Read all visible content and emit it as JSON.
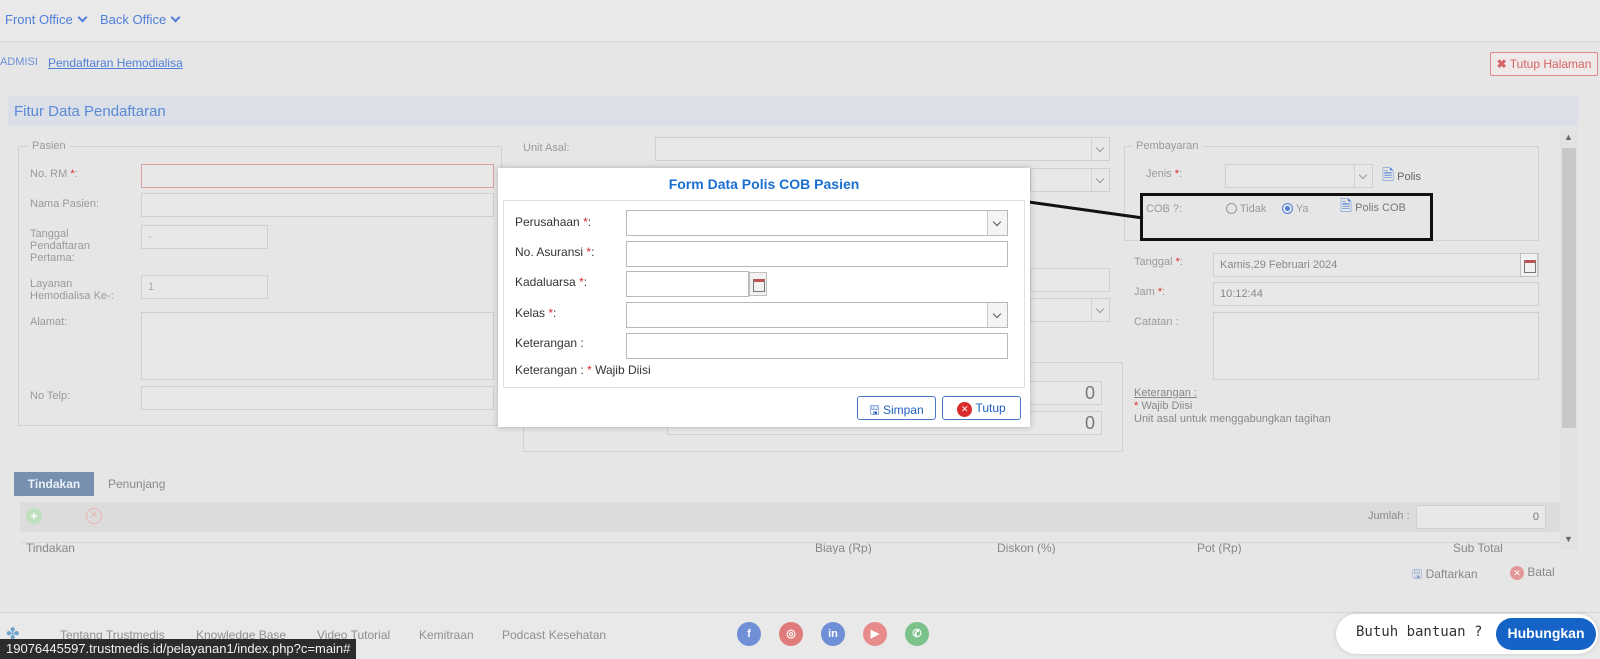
{
  "nav": {
    "front_office": "Front Office",
    "back_office": "Back Office"
  },
  "breadcrumb": {
    "root": "ADMISI",
    "current": "Pendaftaran Hemodialisa"
  },
  "close_page": "Tutup Halaman",
  "panel_title": "Fitur Data Pendaftaran",
  "pasien": {
    "legend": "Pasien",
    "no_rm_label": "No. RM",
    "nama_label": "Nama Pasien:",
    "tanggal_label": "Tanggal Pendaftaran Pertama:",
    "tanggal_value": "-",
    "layanan_label": "Layanan Hemodialisa Ke-:",
    "layanan_value": "1",
    "alamat_label": "Alamat:",
    "telp_label": "No Telp:"
  },
  "unit_asal_label": "Unit Asal:",
  "totals": {
    "value1": "0",
    "value2": "0"
  },
  "pembayaran": {
    "legend": "Pembayaran",
    "jenis_label": "Jenis",
    "polis_label": "Polis",
    "cob_label": "COB ?:",
    "cob_options": [
      "Tidak",
      "Ya"
    ],
    "cob_selected": "Ya",
    "polis_cob_label": "Polis COB",
    "tanggal_label": "Tanggal",
    "tanggal_value": "Kamis,29 Februari 2024",
    "jam_label": "Jam",
    "jam_value": "10:12:44",
    "catatan_label": "Catatan :",
    "keterangan_heading": "Keterangan :",
    "wajib_diisi": "Wajib Diisi",
    "unit_note": "Unit asal untuk menggabungkan tagihan"
  },
  "tabs": [
    "Tindakan",
    "Penunjang"
  ],
  "jumlah_label": "Jumlah :",
  "jumlah_value": "0",
  "table_headers": [
    "Tindakan",
    "Biaya (Rp)",
    "Diskon (%)",
    "Pot (Rp)",
    "Sub Total"
  ],
  "actions": {
    "daftarkan": "Daftarkan",
    "batal": "Batal"
  },
  "modal": {
    "title": "Form Data Polis COB Pasien",
    "perusahaan_label": "Perusahaan",
    "asuransi_label": "No. Asuransi",
    "kadaluarsa_label": "Kadaluarsa",
    "kelas_label": "Kelas",
    "keterangan_label": "Keterangan :",
    "note_prefix": "Keterangan :",
    "note_text": "Wajib Diisi",
    "simpan": "Simpan",
    "tutup": "Tutup"
  },
  "footer_links": [
    "Tentang Trustmedis",
    "Knowledge Base",
    "Video Tutorial",
    "Kemitraan",
    "Podcast Kesehatan"
  ],
  "status_url": "19076445597.trustmedis.id/pelayanan1/index.php?c=main#",
  "help": {
    "text": "Butuh bantuan ?",
    "button": "Hubungkan"
  },
  "colors": {
    "accent": "#1663c7",
    "danger": "#d92b2b"
  }
}
